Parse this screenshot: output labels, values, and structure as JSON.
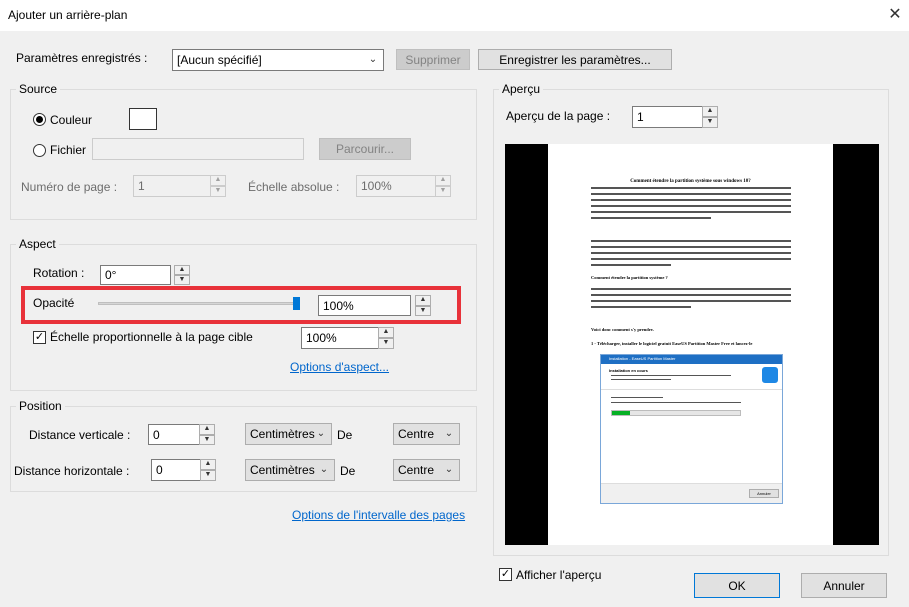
{
  "window": {
    "title": "Ajouter un arrière-plan"
  },
  "saved_settings": {
    "label": "Paramètres enregistrés :",
    "value": "[Aucun spécifié]",
    "delete_label": "Supprimer",
    "save_label": "Enregistrer les paramètres..."
  },
  "source": {
    "legend": "Source",
    "color_label": "Couleur",
    "file_label": "Fichier",
    "browse_label": "Parcourir...",
    "page_number_label": "Numéro de page :",
    "page_number_value": "1",
    "absolute_scale_label": "Échelle absolue :",
    "absolute_scale_value": "100%"
  },
  "aspect": {
    "legend": "Aspect",
    "rotation_label": "Rotation :",
    "rotation_value": "0°",
    "opacity_label": "Opacité",
    "opacity_value": "100%",
    "opacity_fraction": 1.0,
    "proportional_label": "Échelle proportionnelle à la page cible",
    "proportional_value": "100%",
    "options_link": "Options d'aspect..."
  },
  "position": {
    "legend": "Position",
    "vertical_label": "Distance verticale :",
    "vertical_value": "0",
    "vertical_unit": "Centimètres",
    "vertical_of": "De",
    "vertical_anchor": "Centre",
    "horizontal_label": "Distance horizontale :",
    "horizontal_value": "0",
    "horizontal_unit": "Centimètres",
    "horizontal_of": "De",
    "horizontal_anchor": "Centre"
  },
  "page_range_link": "Options de l'intervalle des pages",
  "preview": {
    "legend": "Aperçu",
    "page_label": "Aperçu de la page :",
    "page_value": "1",
    "show_preview_label": "Afficher l'aperçu",
    "doc": {
      "heading": "Comment étendre la partition système sous windows 10?",
      "question": "Comment étendre la partition système ?",
      "steps": "Voici donc comment s'y prendre.",
      "step1": "1 - Télécharger, installer le logiciel gratuit EaseUS Partition Master Free et lancez-le",
      "installer_title": "Installation - EaseUS Partition Master",
      "installer_status": "Installation en cours",
      "installer_button": "Annuler"
    }
  },
  "buttons": {
    "ok": "OK",
    "cancel": "Annuler"
  },
  "colors": {
    "highlight": "#e8323a",
    "progress": "#06b025",
    "link": "#0066cc"
  }
}
